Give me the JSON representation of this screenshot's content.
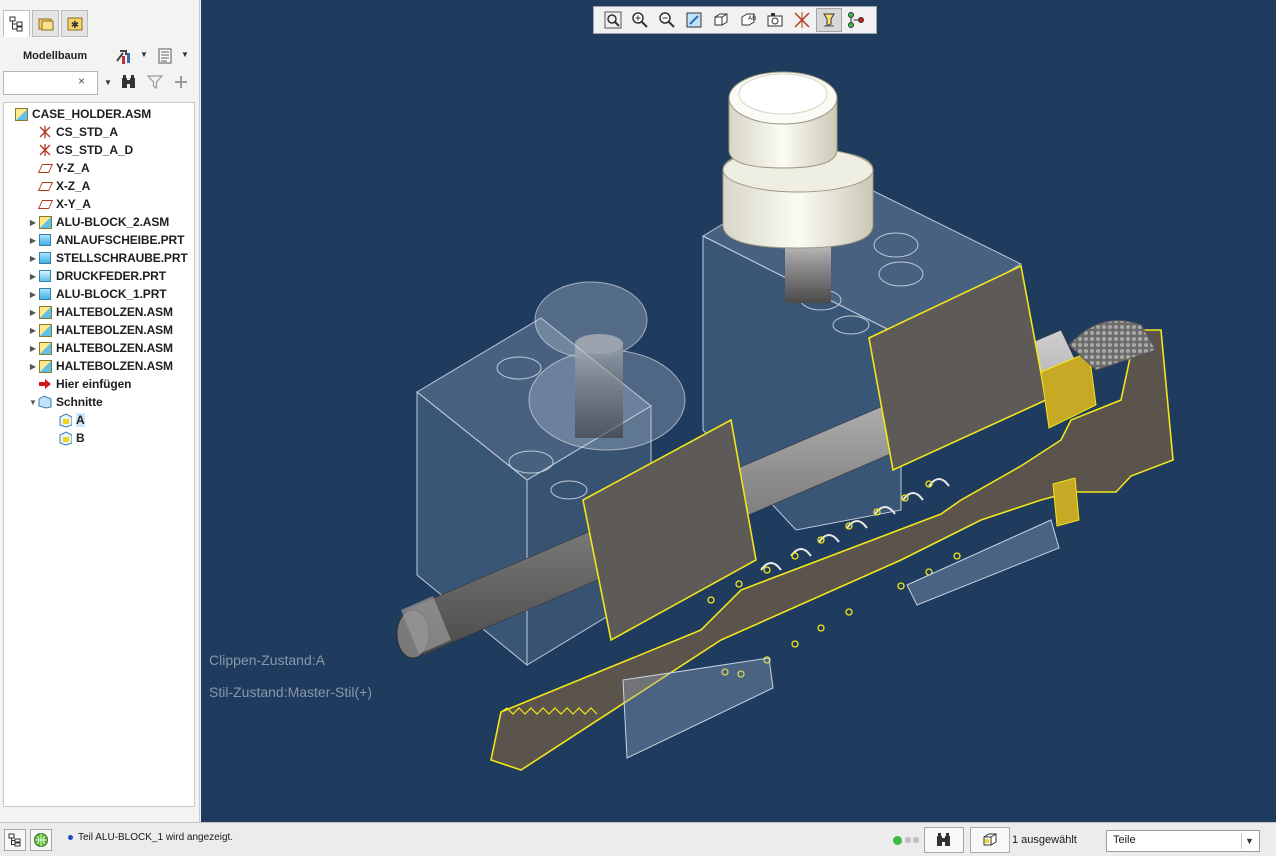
{
  "panel_tabs": [
    {
      "name": "model-tree-tab-icon"
    },
    {
      "name": "folder-browser-tab-icon"
    },
    {
      "name": "favorites-tab-icon"
    }
  ],
  "tree_header": {
    "title": "Modellbaum"
  },
  "search": {
    "value": "",
    "clear_symbol": "×"
  },
  "tree": {
    "items": [
      {
        "label": "CASE_HOLDER.ASM",
        "icon": "assembly-icon",
        "indent": 0,
        "expander": ""
      },
      {
        "label": "CS_STD_A",
        "icon": "coordinate-system-icon",
        "indent": 1,
        "expander": ""
      },
      {
        "label": "CS_STD_A_D",
        "icon": "coordinate-system-icon",
        "indent": 1,
        "expander": ""
      },
      {
        "label": "Y-Z_A",
        "icon": "datum-plane-icon",
        "indent": 1,
        "expander": ""
      },
      {
        "label": "X-Z_A",
        "icon": "datum-plane-icon",
        "indent": 1,
        "expander": ""
      },
      {
        "label": "X-Y_A",
        "icon": "datum-plane-icon",
        "indent": 1,
        "expander": ""
      },
      {
        "label": "ALU-BLOCK_2.ASM",
        "icon": "assembly-icon",
        "indent": 1,
        "expander": "▶"
      },
      {
        "label": "ANLAUFSCHEIBE.PRT",
        "icon": "part-icon",
        "indent": 1,
        "expander": "▶"
      },
      {
        "label": "STELLSCHRAUBE.PRT",
        "icon": "part-icon",
        "indent": 1,
        "expander": "▶"
      },
      {
        "label": "DRUCKFEDER.PRT",
        "icon": "flexible-part-icon",
        "indent": 1,
        "expander": "▶"
      },
      {
        "label": "ALU-BLOCK_1.PRT",
        "icon": "part-icon",
        "indent": 1,
        "expander": "▶"
      },
      {
        "label": "HALTEBOLZEN.ASM",
        "icon": "assembly-icon",
        "indent": 1,
        "expander": "▶"
      },
      {
        "label": "HALTEBOLZEN.ASM",
        "icon": "assembly-icon",
        "indent": 1,
        "expander": "▶"
      },
      {
        "label": "HALTEBOLZEN.ASM",
        "icon": "assembly-icon",
        "indent": 1,
        "expander": "▶"
      },
      {
        "label": "HALTEBOLZEN.ASM",
        "icon": "assembly-icon",
        "indent": 1,
        "expander": "▶"
      },
      {
        "label": "Hier einfügen",
        "icon": "insert-here-arrow-icon",
        "indent": 1,
        "expander": ""
      },
      {
        "label": "Schnitte",
        "icon": "sections-folder-icon",
        "indent": 1,
        "expander": "▼"
      },
      {
        "label": "A",
        "icon": "section-icon",
        "indent": 2,
        "expander": ""
      },
      {
        "label": "B",
        "icon": "section-icon",
        "indent": 2,
        "expander": ""
      }
    ]
  },
  "view_toolbar": {
    "buttons": [
      "refit-icon",
      "zoom-in-icon",
      "zoom-out-icon",
      "repaint-icon",
      "display-style-icon",
      "saved-orientations-icon",
      "view-manager-icon",
      "datum-display-filters-icon",
      "spin-center-icon",
      "annotation-display-icon"
    ]
  },
  "viewport": {
    "clip_state": "Clippen-Zustand:A",
    "style_state": "Stil-Zustand:Master-Stil(+)"
  },
  "status": {
    "message": "Teil ALU-BLOCK_1 wird angezeigt.",
    "selection_count": "1 ausgewählt",
    "filter_value": "Teile"
  },
  "colors": {
    "viewport_background": "#1f3b5e",
    "section_highlight": "#f2e61b"
  }
}
